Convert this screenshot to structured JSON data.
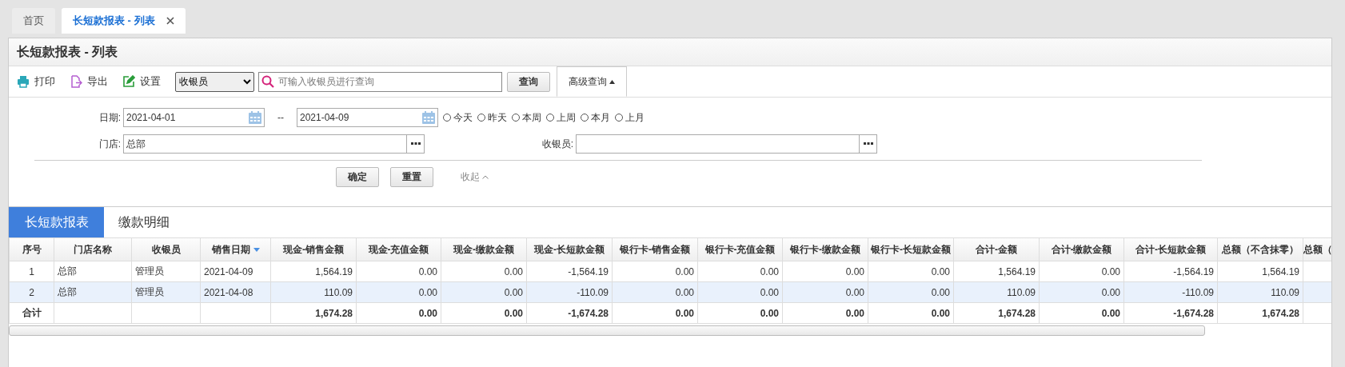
{
  "tabs": [
    {
      "label": "首页",
      "selected": false,
      "closable": false
    },
    {
      "label": "长短款报表 - 列表",
      "selected": true,
      "closable": true
    }
  ],
  "panel": {
    "title": "长短款报表 - 列表"
  },
  "toolbar": {
    "actions": [
      {
        "kind": "print",
        "label": "打印"
      },
      {
        "kind": "export",
        "label": "导出"
      },
      {
        "kind": "settings",
        "label": "设置"
      }
    ],
    "field_select": "收银员",
    "search": {
      "placeholder": "可输入收银员进行查询"
    },
    "query": "查询",
    "advanced": {
      "label": "高级查询",
      "expanded": true
    }
  },
  "filter": {
    "date_label": "日期:",
    "date_from": "2021-04-01",
    "date_sep": "--",
    "date_to": "2021-04-09",
    "ranges": [
      {
        "label": "今天",
        "checked": false
      },
      {
        "label": "昨天",
        "checked": false
      },
      {
        "label": "本周",
        "checked": false
      },
      {
        "label": "上周",
        "checked": false
      },
      {
        "label": "本月",
        "checked": false
      },
      {
        "label": "上月",
        "checked": false
      }
    ],
    "store_label": "门店:",
    "store_value": "总部",
    "cashier_label": "收银员:",
    "confirm": "确定",
    "reset": "重置",
    "collapse": "收起"
  },
  "report_tabs": [
    {
      "label": "长短款报表",
      "selected": true
    },
    {
      "label": "缴款明细",
      "selected": false
    }
  ],
  "table": {
    "columns": [
      {
        "label": "序号",
        "kind": "index"
      },
      {
        "label": "门店名称",
        "kind": "text"
      },
      {
        "label": "收银员",
        "kind": "text"
      },
      {
        "label": "销售日期",
        "kind": "text",
        "sorted": true
      },
      {
        "label": "现金-销售金额",
        "kind": "number"
      },
      {
        "label": "现金-充值金额",
        "kind": "number"
      },
      {
        "label": "现金-缴款金额",
        "kind": "number"
      },
      {
        "label": "现金-长短款金额",
        "kind": "number"
      },
      {
        "label": "银行卡-销售金额",
        "kind": "number"
      },
      {
        "label": "银行卡-充值金额",
        "kind": "number"
      },
      {
        "label": "银行卡-缴款金额",
        "kind": "number"
      },
      {
        "label": "银行卡-长短款金额",
        "kind": "number"
      },
      {
        "label": "合计-金额",
        "kind": "number"
      },
      {
        "label": "合计-缴款金额",
        "kind": "number"
      },
      {
        "label": "合计-长短款金额",
        "kind": "number"
      },
      {
        "label": "总额（不含抹零）",
        "kind": "number"
      },
      {
        "label": "总额（",
        "kind": "number"
      }
    ],
    "rows": [
      {
        "selected": false,
        "cells": [
          "1",
          "总部",
          "管理员",
          "2021-04-09",
          "1,564.19",
          "0.00",
          "0.00",
          "-1,564.19",
          "0.00",
          "0.00",
          "0.00",
          "0.00",
          "1,564.19",
          "0.00",
          "-1,564.19",
          "1,564.19"
        ]
      },
      {
        "selected": true,
        "cells": [
          "2",
          "总部",
          "管理员",
          "2021-04-08",
          "110.09",
          "0.00",
          "0.00",
          "-110.09",
          "0.00",
          "0.00",
          "0.00",
          "0.00",
          "110.09",
          "0.00",
          "-110.09",
          "110.09"
        ]
      }
    ],
    "total": {
      "label": "合计",
      "cells": [
        "",
        "",
        "",
        "1,674.28",
        "0.00",
        "0.00",
        "-1,674.28",
        "0.00",
        "0.00",
        "0.00",
        "0.00",
        "1,674.28",
        "0.00",
        "-1,674.28",
        "1,674.28"
      ]
    }
  }
}
